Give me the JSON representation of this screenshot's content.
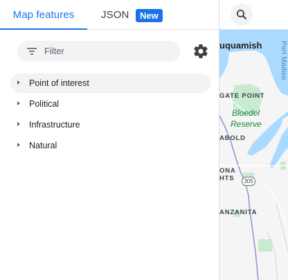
{
  "tabs": {
    "map_features": "Map features",
    "json": "JSON",
    "new_badge": "New"
  },
  "filter": {
    "placeholder": "Filter"
  },
  "tree": [
    {
      "label": "Point of interest",
      "selected": true
    },
    {
      "label": "Political",
      "selected": false
    },
    {
      "label": "Infrastructure",
      "selected": false
    },
    {
      "label": "Natural",
      "selected": false
    }
  ],
  "map": {
    "labels": {
      "suquamish": "uquamish",
      "gate_point": "GATE POINT",
      "bloedel_line1": "Bloedel",
      "bloedel_line2": "Reserve",
      "rolling_bay": "ABOLD",
      "arona_line1": "ONA",
      "arona_line2": "HTS",
      "route": "305",
      "manzanita": "ANZANITA",
      "port_madison": "Port Madiso"
    }
  },
  "colors": {
    "accent": "#1a73e8",
    "water": "#aadaff",
    "land": "#f5f5f5",
    "park": "#c8ebd0",
    "road": "#8a9bd0"
  },
  "icons": {
    "filter": "filter-icon",
    "settings": "gear-icon",
    "search": "search-icon",
    "expand": "caret-right-icon"
  }
}
